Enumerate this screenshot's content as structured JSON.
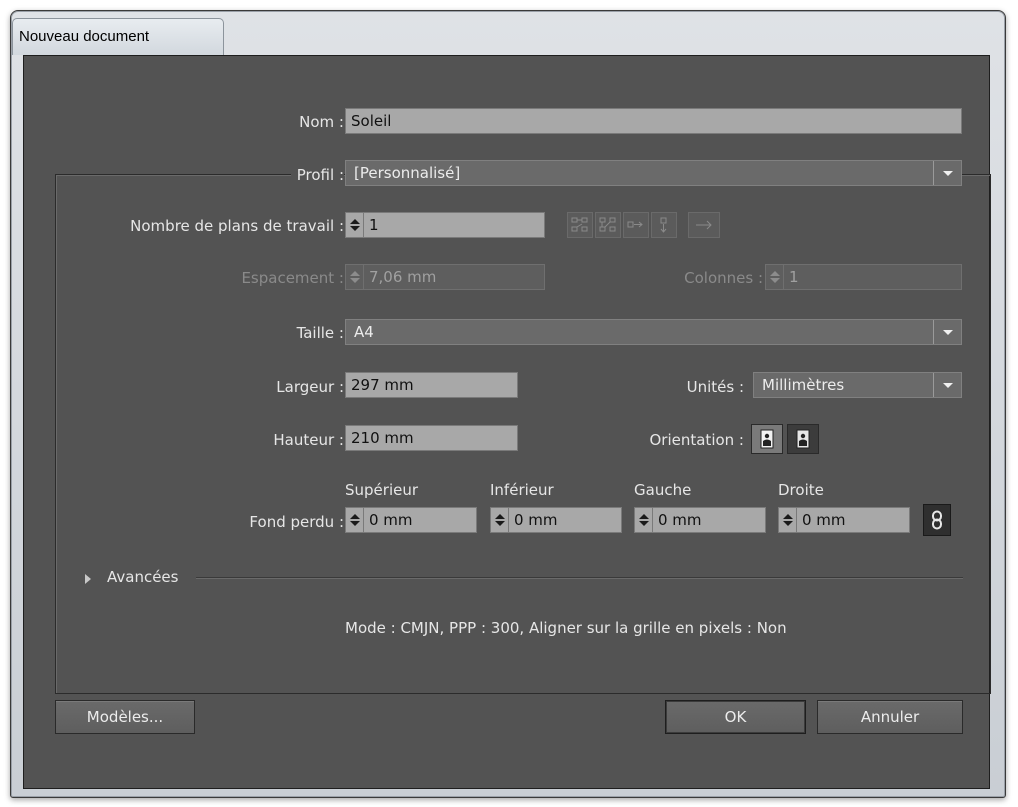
{
  "window": {
    "title": "Nouveau document"
  },
  "name": {
    "label": "Nom :",
    "value": "Soleil"
  },
  "profile": {
    "label": "Profil :",
    "value": "[Personnalisé]"
  },
  "artboards": {
    "label": "Nombre de plans de travail :",
    "value": "1"
  },
  "spacing": {
    "label": "Espacement :",
    "value": "7,06 mm"
  },
  "columns": {
    "label": "Colonnes :",
    "value": "1"
  },
  "size": {
    "label": "Taille :",
    "value": "A4"
  },
  "width": {
    "label": "Largeur :",
    "value": "297 mm"
  },
  "units": {
    "label": "Unités :",
    "value": "Millimètres"
  },
  "height": {
    "label": "Hauteur :",
    "value": "210 mm"
  },
  "orientation": {
    "label": "Orientation :"
  },
  "bleed": {
    "label": "Fond perdu :",
    "top": {
      "label": "Supérieur",
      "value": "0 mm"
    },
    "bottom": {
      "label": "Inférieur",
      "value": "0 mm"
    },
    "left": {
      "label": "Gauche",
      "value": "0 mm"
    },
    "right": {
      "label": "Droite",
      "value": "0 mm"
    }
  },
  "advanced": {
    "label": "Avancées"
  },
  "summary": "Mode : CMJN, PPP : 300, Aligner sur la grille en pixels : Non",
  "buttons": {
    "templates": "Modèles...",
    "ok": "OK",
    "cancel": "Annuler"
  },
  "icons": {
    "grid_by_row": "grid-by-row-icon",
    "grid_by_column": "grid-by-column-icon",
    "arrange_by_row": "arrange-by-row-icon",
    "arrange_by_column": "arrange-by-column-icon",
    "right_to_left": "arrow-right-icon",
    "portrait": "portrait-orientation-icon",
    "landscape": "landscape-orientation-icon",
    "link": "chain-link-icon"
  },
  "colors": {
    "dialog_bg": "#535353",
    "field_bg": "#a8a8a8",
    "field_dim_bg": "#5e5e5e",
    "text": "#e6e6e6"
  }
}
